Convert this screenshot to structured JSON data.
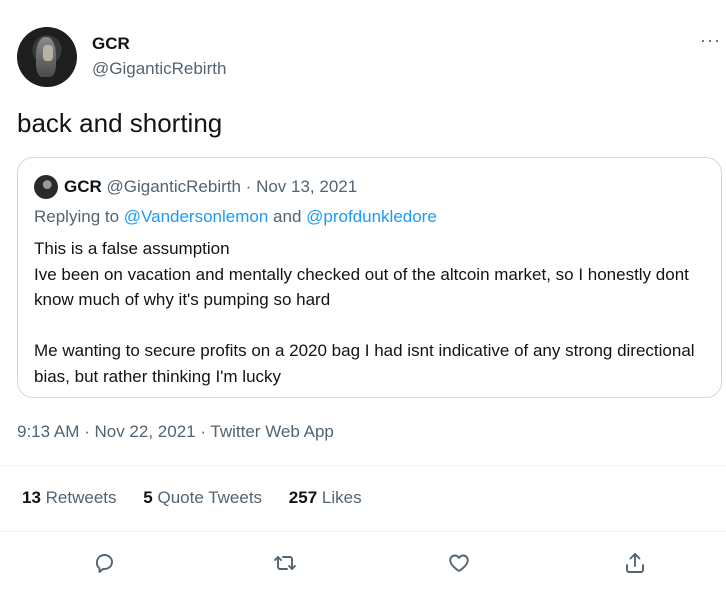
{
  "tweet": {
    "display_name": "GCR",
    "handle": "@GiganticRebirth",
    "text": "back and shorting",
    "more_label": "···"
  },
  "quote": {
    "display_name": "GCR",
    "handle": "@GiganticRebirth",
    "separator": " · ",
    "date": "Nov 13, 2021",
    "replying_prefix": "Replying to ",
    "replying_user1": "@Vandersonlemon",
    "replying_and": " and ",
    "replying_user2": "@profdunkledore",
    "body": "This is a false assumption\nIve been on vacation and mentally checked out of the altcoin market, so I honestly dont know much of why it's pumping so hard\n\nMe wanting to secure profits on a 2020 bag I had isnt indicative of any strong directional bias, but rather thinking I'm lucky"
  },
  "meta": {
    "timestamp": "9:13 AM · Nov 22, 2021 · Twitter Web App"
  },
  "stats": {
    "retweets_count": "13",
    "retweets_label": "Retweets",
    "quotes_count": "5",
    "quotes_label": "Quote Tweets",
    "likes_count": "257",
    "likes_label": "Likes"
  },
  "actions": {
    "reply_icon": "reply-icon",
    "retweet_icon": "retweet-icon",
    "like_icon": "heart-icon",
    "share_icon": "share-icon"
  },
  "colors": {
    "text": "#0f1419",
    "secondary": "#536471",
    "link": "#1d9bf0",
    "border": "#cfd9de"
  }
}
